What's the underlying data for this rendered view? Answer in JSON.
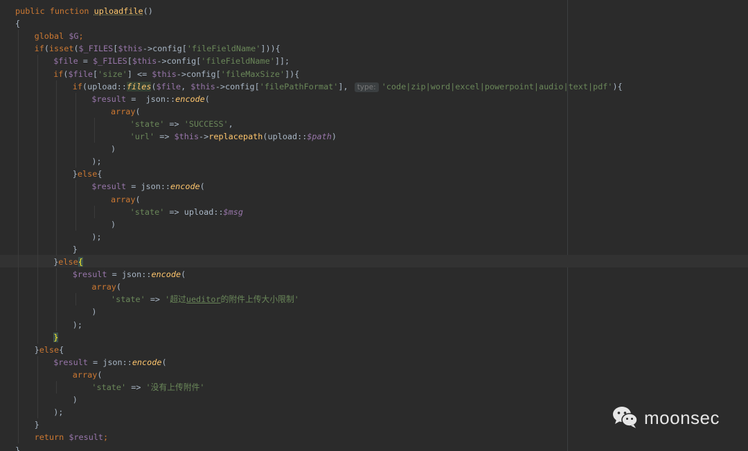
{
  "editor": {
    "lines": [
      [
        [
          "kw",
          "public function "
        ],
        [
          "fnu",
          "uploadfile"
        ],
        [
          "p",
          "()"
        ]
      ],
      [
        [
          "p",
          "{"
        ]
      ],
      [
        [
          "kw",
          "global "
        ],
        [
          "var",
          "$G"
        ],
        [
          "kw",
          ";"
        ]
      ],
      [
        [
          "kw",
          "if"
        ],
        [
          "p",
          "("
        ],
        [
          "kw",
          "isset"
        ],
        [
          "p",
          "("
        ],
        [
          "var",
          "$_FILES"
        ],
        [
          "p",
          "["
        ],
        [
          "var",
          "$this"
        ],
        [
          "p",
          "->config["
        ],
        [
          "str",
          "'fileFieldName'"
        ],
        [
          "p",
          "])){"
        ]
      ],
      [
        [
          "var",
          "$file"
        ],
        [
          "p",
          " = "
        ],
        [
          "var",
          "$_FILES"
        ],
        [
          "p",
          "["
        ],
        [
          "var",
          "$this"
        ],
        [
          "p",
          "->config["
        ],
        [
          "str",
          "'fileFieldName'"
        ],
        [
          "p",
          "]];"
        ]
      ],
      [
        [
          "kw",
          "if"
        ],
        [
          "p",
          "("
        ],
        [
          "var",
          "$file"
        ],
        [
          "p",
          "["
        ],
        [
          "str",
          "'size'"
        ],
        [
          "p",
          "] <= "
        ],
        [
          "var",
          "$this"
        ],
        [
          "p",
          "->config["
        ],
        [
          "str",
          "'fileMaxSize'"
        ],
        [
          "p",
          "]){"
        ]
      ],
      [
        [
          "kw",
          "if"
        ],
        [
          "p",
          "(upload::"
        ],
        [
          "hl",
          "files"
        ],
        [
          "p",
          "("
        ],
        [
          "var",
          "$file"
        ],
        [
          "p",
          ", "
        ],
        [
          "var",
          "$this"
        ],
        [
          "p",
          "->config["
        ],
        [
          "str",
          "'filePathFormat'"
        ],
        [
          "p",
          "], "
        ],
        [
          "hint",
          "type:"
        ],
        [
          "str",
          "'code|zip|word|excel|powerpoint|audio|text|pdf'"
        ],
        [
          "p",
          "){"
        ]
      ],
      [
        [
          "var",
          "$result"
        ],
        [
          "p",
          " =  json::"
        ],
        [
          "fni",
          "encode"
        ],
        [
          "p",
          "("
        ]
      ],
      [
        [
          "kw",
          "array"
        ],
        [
          "p",
          "("
        ]
      ],
      [
        [
          "str",
          "'state'"
        ],
        [
          "p",
          " => "
        ],
        [
          "str",
          "'SUCCESS'"
        ],
        [
          "p",
          ","
        ]
      ],
      [
        [
          "str",
          "'url'"
        ],
        [
          "p",
          " => "
        ],
        [
          "var",
          "$this"
        ],
        [
          "p",
          "->"
        ],
        [
          "fn",
          "replacepath"
        ],
        [
          "p",
          "(upload::"
        ],
        [
          "vari",
          "$path"
        ],
        [
          "p",
          ")"
        ]
      ],
      [
        [
          "p",
          ")"
        ]
      ],
      [
        [
          "p",
          ");"
        ]
      ],
      [
        [
          "p",
          "}"
        ],
        [
          "kw",
          "else"
        ],
        [
          "p",
          "{"
        ]
      ],
      [
        [
          "var",
          "$result"
        ],
        [
          "p",
          " = json::"
        ],
        [
          "fni",
          "encode"
        ],
        [
          "p",
          "("
        ]
      ],
      [
        [
          "kw",
          "array"
        ],
        [
          "p",
          "("
        ]
      ],
      [
        [
          "str",
          "'state'"
        ],
        [
          "p",
          " => upload::"
        ],
        [
          "vari",
          "$msg"
        ]
      ],
      [
        [
          "p",
          ")"
        ]
      ],
      [
        [
          "p",
          ");"
        ]
      ],
      [
        [
          "p",
          "}"
        ]
      ],
      [
        [
          "p",
          "}"
        ],
        [
          "kw",
          "else"
        ],
        [
          "br",
          "{"
        ]
      ],
      [
        [
          "var",
          "$result"
        ],
        [
          "p",
          " = json::"
        ],
        [
          "fni",
          "encode"
        ],
        [
          "p",
          "("
        ]
      ],
      [
        [
          "kw",
          "array"
        ],
        [
          "p",
          "("
        ]
      ],
      [
        [
          "str",
          "'state'"
        ],
        [
          "p",
          " => "
        ],
        [
          "str",
          "'超过"
        ],
        [
          "stru",
          "ueditor"
        ],
        [
          "str",
          "的附件上传大小限制'"
        ]
      ],
      [
        [
          "p",
          ")"
        ]
      ],
      [
        [
          "p",
          ");"
        ]
      ],
      [
        [
          "br",
          "}"
        ]
      ],
      [
        [
          "p",
          "}"
        ],
        [
          "kw",
          "else"
        ],
        [
          "p",
          "{"
        ]
      ],
      [
        [
          "var",
          "$result"
        ],
        [
          "p",
          " = json::"
        ],
        [
          "fni",
          "encode"
        ],
        [
          "p",
          "("
        ]
      ],
      [
        [
          "kw",
          "array"
        ],
        [
          "p",
          "("
        ]
      ],
      [
        [
          "str",
          "'state'"
        ],
        [
          "p",
          " => "
        ],
        [
          "str",
          "'没有上传附件'"
        ]
      ],
      [
        [
          "p",
          ")"
        ]
      ],
      [
        [
          "p",
          ");"
        ]
      ],
      [
        [
          "p",
          "}"
        ]
      ],
      [
        [
          "kw",
          "return "
        ],
        [
          "var",
          "$result"
        ],
        [
          "kw",
          ";"
        ]
      ],
      [
        [
          "p",
          "}"
        ]
      ]
    ]
  },
  "watermark": {
    "text": "moonsec",
    "icon": "wechat-icon"
  }
}
